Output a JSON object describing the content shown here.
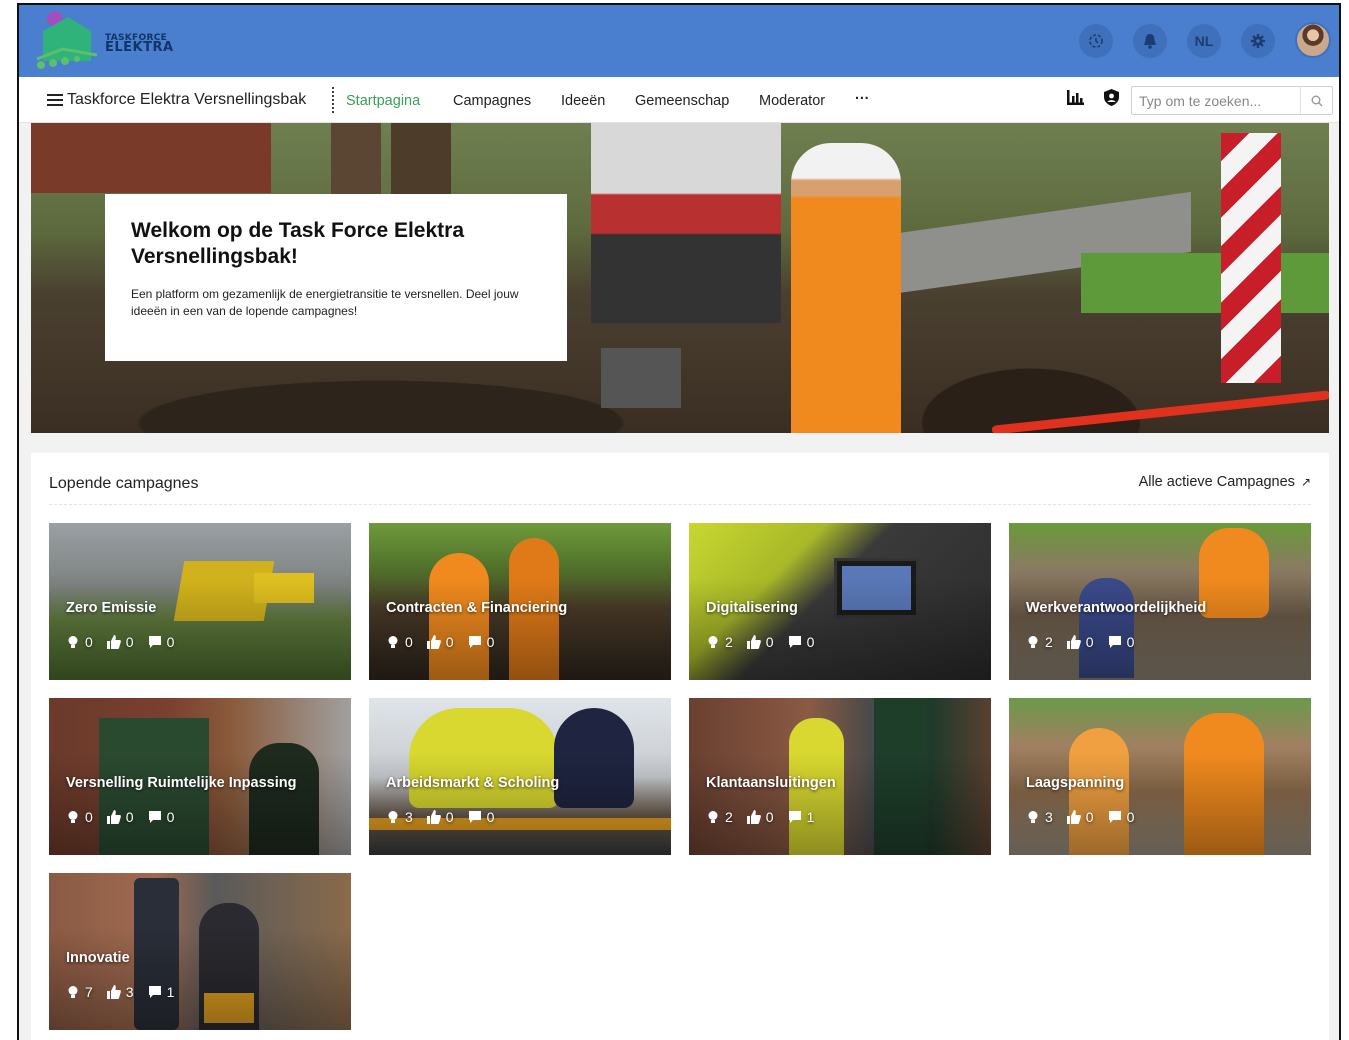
{
  "header": {
    "logo_line1": "TASKFORCE",
    "logo_line2": "ELEKTRA",
    "language": "NL",
    "colors": {
      "topbar": "#4a7fcf",
      "accent": "#3aa05a"
    }
  },
  "nav": {
    "site_title": "Taskforce Elektra Versnellingsbak",
    "items": [
      {
        "label": "Startpagina",
        "active": true
      },
      {
        "label": "Campagnes"
      },
      {
        "label": "Ideeën"
      },
      {
        "label": "Gemeenschap"
      },
      {
        "label": "Moderator"
      },
      {
        "label": "···"
      }
    ],
    "search_placeholder": "Typ om te zoeken..."
  },
  "hero": {
    "title": "Welkom op de Task Force Elektra Versnellingsbak!",
    "text": "Een platform om gezamenlijk de energietransitie te versnellen. Deel jouw ideeën in een van de lopende campagnes!"
  },
  "campaigns": {
    "title": "Lopende campagnes",
    "all_link": "Alle actieve Campagnes",
    "all_link_icon": "↗",
    "items": [
      {
        "name": "Zero Emissie",
        "ideas": "0",
        "likes": "0",
        "comments": "0"
      },
      {
        "name": "Contracten & Financiering",
        "ideas": "0",
        "likes": "0",
        "comments": "0"
      },
      {
        "name": "Digitalisering",
        "ideas": "2",
        "likes": "0",
        "comments": "0"
      },
      {
        "name": "Werkverantwoordelijkheid",
        "ideas": "2",
        "likes": "0",
        "comments": "0"
      },
      {
        "name": "Versnelling Ruimtelijke Inpassing",
        "ideas": "0",
        "likes": "0",
        "comments": "0"
      },
      {
        "name": "Arbeidsmarkt & Scholing",
        "ideas": "3",
        "likes": "0",
        "comments": "0"
      },
      {
        "name": "Klantaansluitingen",
        "ideas": "2",
        "likes": "0",
        "comments": "1"
      },
      {
        "name": "Laagspanning",
        "ideas": "3",
        "likes": "0",
        "comments": "0"
      },
      {
        "name": "Innovatie",
        "ideas": "7",
        "likes": "3",
        "comments": "1"
      }
    ]
  }
}
